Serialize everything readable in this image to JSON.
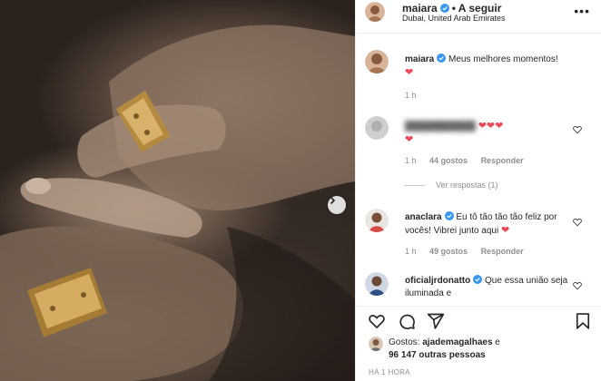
{
  "post": {
    "author": "maiara",
    "follow_label": "• A seguir",
    "location": "Dubai, United Arab Emirates"
  },
  "caption": {
    "user": "maiara",
    "text": "Meus melhores momentos!",
    "emoji": "❤",
    "time": "1 h"
  },
  "comments": [
    {
      "user": "",
      "text": "❤❤❤",
      "emoji": "❤",
      "time": "1 h",
      "likes": "44 gostos",
      "reply": "Responder",
      "view_replies": "Ver respostas (1)"
    },
    {
      "user": "anaclara",
      "text": "Eu tô tão tão tão feliz por vocês! Vibrei junto aqui",
      "emoji": "❤",
      "time": "1 h",
      "likes": "49 gostos",
      "reply": "Responder"
    },
    {
      "user": "oficialjrdonatto",
      "text": "Que essa união seja iluminada e"
    }
  ],
  "likes": {
    "prefix": "Gostos:",
    "user": "ajademagalhaes",
    "connector": "e",
    "others": "96 147 outras pessoas"
  },
  "timestamp": "HÁ 1 HORA",
  "icons": {
    "verified": "verified-badge-icon",
    "heart": "heart-icon",
    "comment": "comment-icon",
    "share": "share-icon",
    "save": "bookmark-icon",
    "more": "more-icon",
    "next": "chevron-right-icon"
  },
  "colors": {
    "verified": "#3897f0",
    "heart": "#ed4956",
    "muted": "#8e8e8e"
  }
}
